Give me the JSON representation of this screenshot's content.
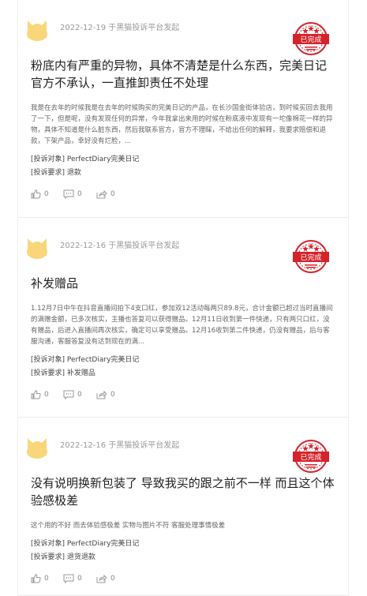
{
  "complaints": [
    {
      "meta": "2022-12-19 于黑猫投诉平台发起",
      "status": "已完成",
      "title": "粉底内有严重的异物，具体不清楚是什么东西，完美日记官方不承认，一直推卸责任不处理",
      "body": "我是在去年的时候我是在去年的时候购买的完美日记的产品，在长沙国金街体验店，到时候买回去我用了一下，但是呢，没有发现任何的异常，今年我拿出来用的时候在粉底液中发现有一坨像棉花一样的异物，具体不知道是什么脏东西，然后我联系官方，官方不理睬，不给出任何的解释，我要求赔偿和退款，下架产品，幸好没有烂脸，...",
      "target_label": "[投诉对象]",
      "target_value": "PerfectDiary完美日记",
      "request_label": "[投诉要求]",
      "request_value": "退款",
      "likes": "0",
      "comments": "0",
      "shares": "0"
    },
    {
      "meta": "2022-12-16 于黑猫投诉平台发起",
      "status": "已完成",
      "title": "补发赠品",
      "body": "1.12月7日中午在抖音直播间拍下4支口红，参加双12活动每两只89.8元，合计金额已超过当时直播间的满赠金额，已多次核实，主播也答复可以获得赠品。12月11日收到第一件快递，只有两只口红，没有赠品，后进入直播间再次核实，确定可以享受赠品。12月16收到第二件快递，仍没有赠品，后与客服沟通，客服答复没有达到现在的满...",
      "target_label": "[投诉对象]",
      "target_value": "PerfectDiary完美日记",
      "request_label": "[投诉要求]",
      "request_value": "补发赠品",
      "likes": "0",
      "comments": "0",
      "shares": "0"
    },
    {
      "meta": "2022-12-16 于黑猫投诉平台发起",
      "status": "已完成",
      "title": "没有说明换新包装了 导致我买的跟之前不一样 而且这个体验感极差",
      "body": "这个用的不好 而去体验感极差 实物与图片不符 客服处理事情极差",
      "target_label": "[投诉对象]",
      "target_value": "PerfectDiary完美日记",
      "request_label": "[投诉要求]",
      "request_value": "退货退款",
      "likes": "0",
      "comments": "0",
      "shares": "0"
    }
  ],
  "colors": {
    "stamp_red": "#d4232b",
    "avatar_yellow": "#f9d679"
  }
}
